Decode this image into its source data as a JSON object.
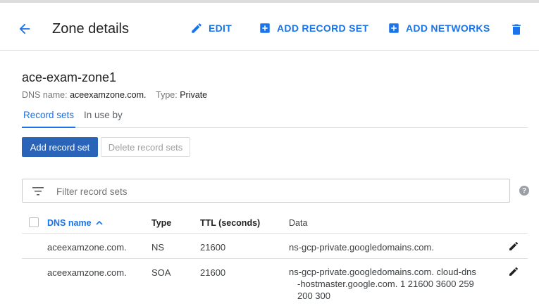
{
  "header": {
    "title": "Zone details",
    "actions": {
      "edit": "EDIT",
      "add_record_set": "ADD RECORD SET",
      "add_networks": "ADD NETWORKS"
    }
  },
  "zone": {
    "name": "ace-exam-zone1",
    "dns_label": "DNS name:",
    "dns_value": "aceexamzone.com.",
    "type_label": "Type:",
    "type_value": "Private"
  },
  "tabs": [
    "Record sets",
    "In use by"
  ],
  "buttons": {
    "add_record_set": "Add record set",
    "delete_record_sets": "Delete record sets"
  },
  "filter": {
    "placeholder": "Filter record sets"
  },
  "table": {
    "columns": [
      "DNS name",
      "Type",
      "TTL (seconds)",
      "Data"
    ],
    "rows": [
      {
        "dns_name": "aceexamzone.com.",
        "type": "NS",
        "ttl": "21600",
        "data": "ns-gcp-private.googledomains.com."
      },
      {
        "dns_name": "aceexamzone.com.",
        "type": "SOA",
        "ttl": "21600",
        "data_line1": "ns-gcp-private.googledomains.com. cloud-dns",
        "data_line2": "-hostmaster.google.com. 1 21600 3600 259",
        "data_line3": "200 300"
      }
    ]
  },
  "colors": {
    "accent": "#1a73e8",
    "primary_button": "#2a64b9"
  }
}
